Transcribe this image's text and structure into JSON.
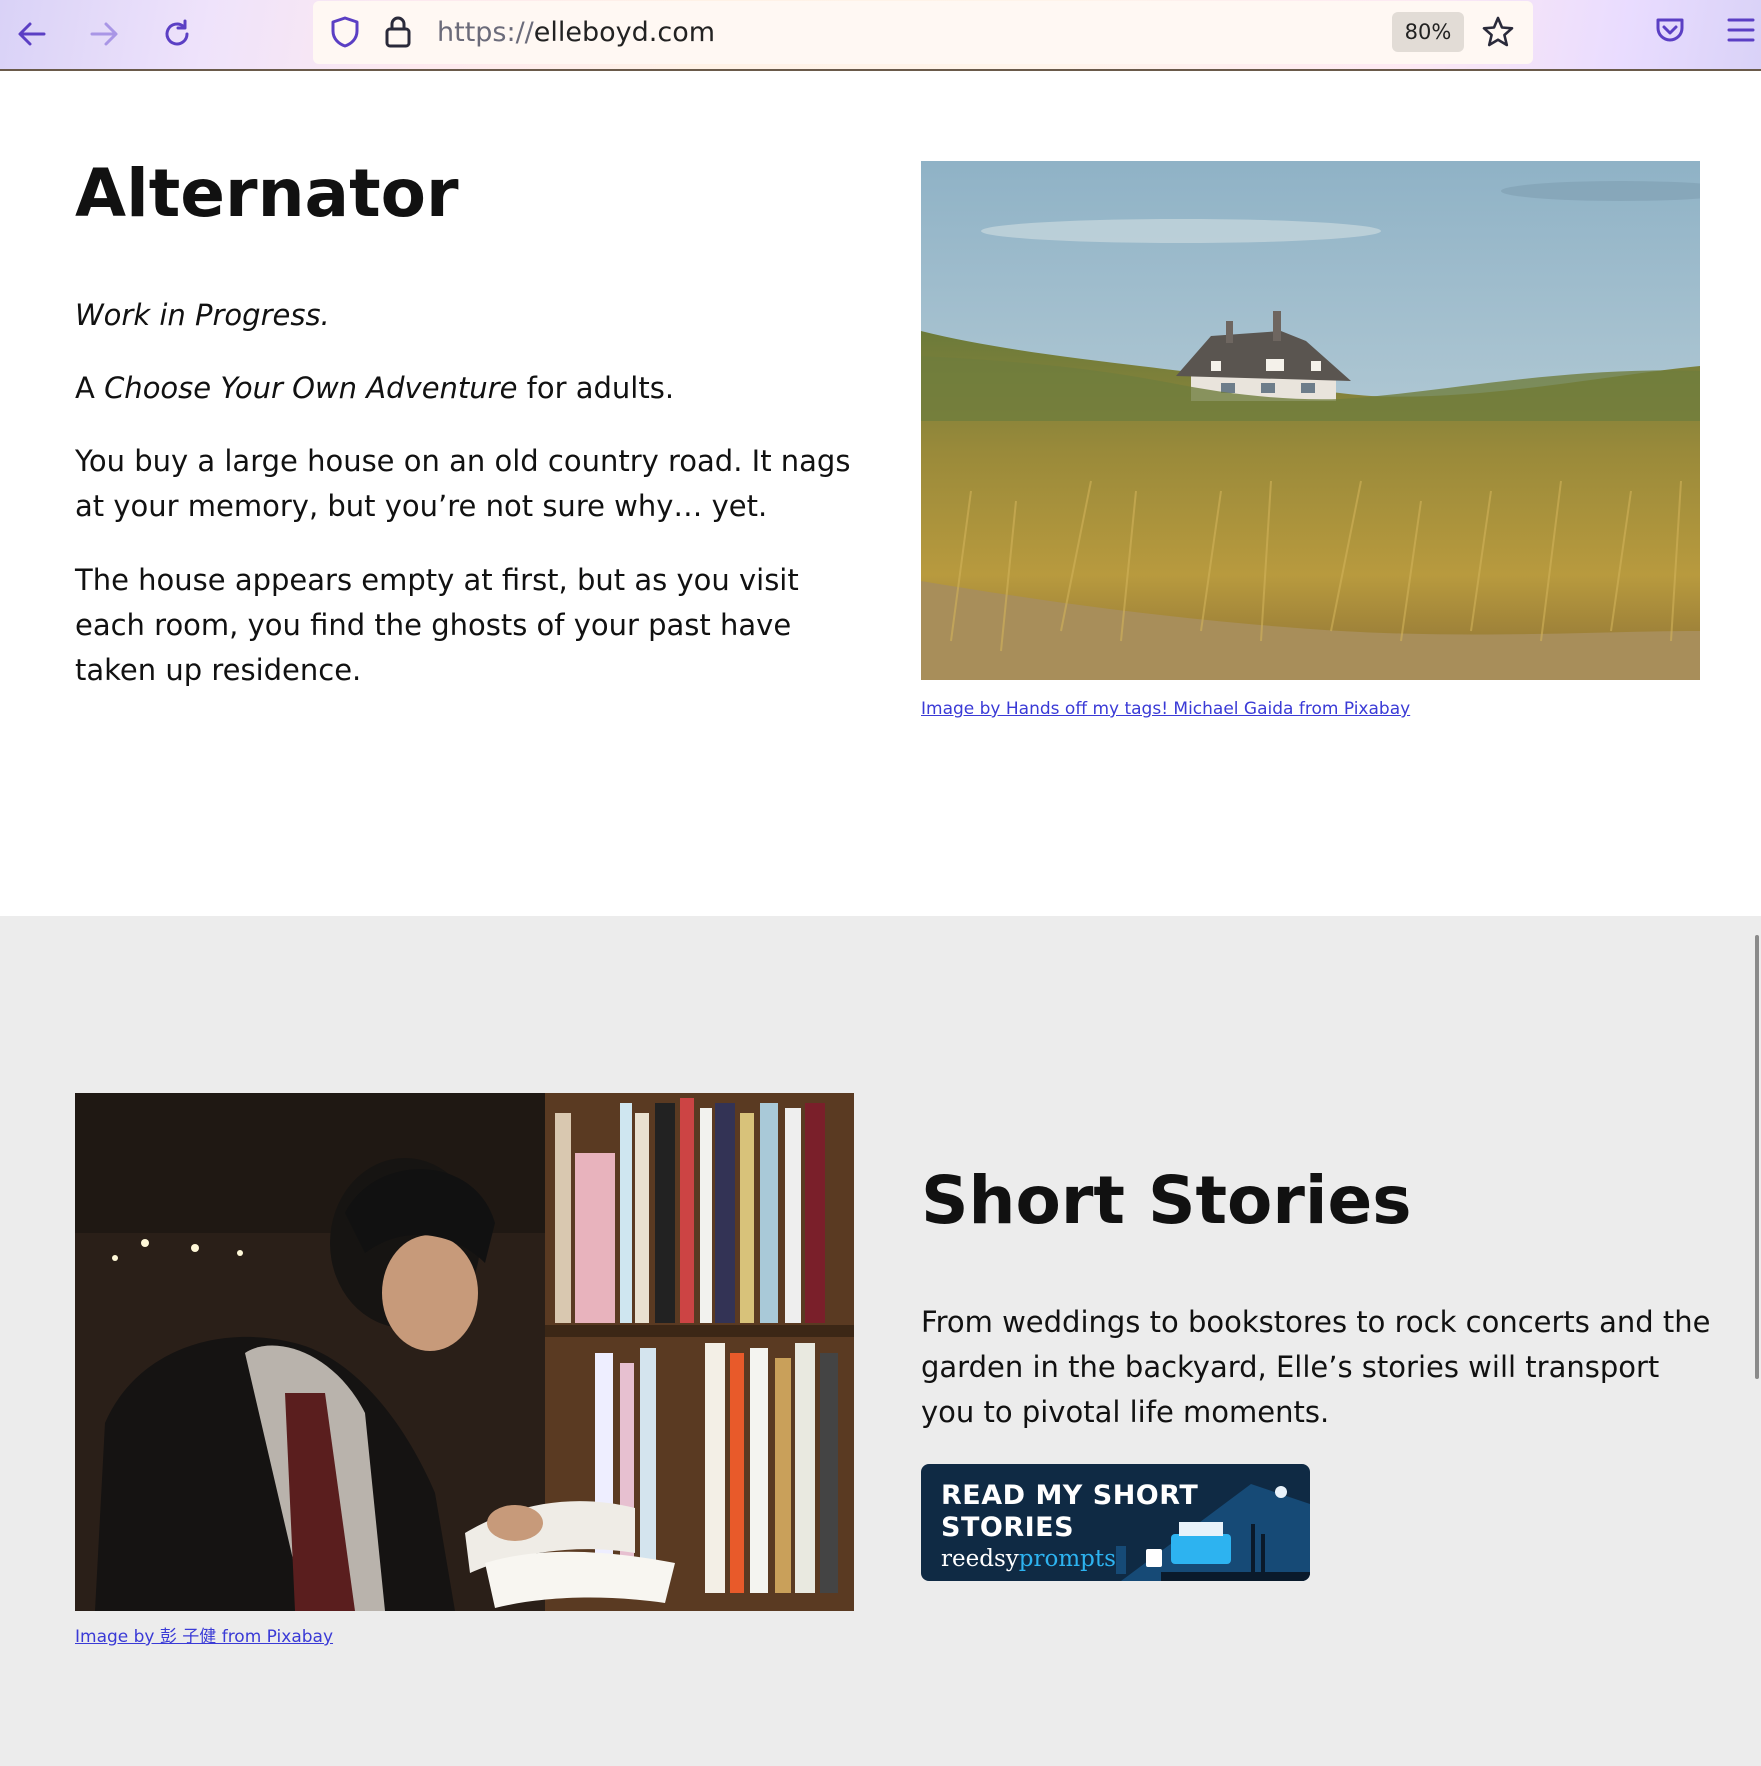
{
  "browser": {
    "url_protocol": "https://",
    "url_host": "elleboyd.com",
    "zoom_label": "80%",
    "icons": [
      "back-arrow-icon",
      "forward-arrow-icon",
      "reload-icon",
      "shield-icon",
      "lock-icon",
      "star-icon",
      "pocket-icon",
      "menu-icon"
    ]
  },
  "alternator": {
    "title": "Alternator",
    "status": "Work in Progress.",
    "tagline_prefix": "A ",
    "tagline_italic": "Choose Your Own Adventure",
    "tagline_suffix": " for adults.",
    "para1": "You buy a large house on an old country road. It nags at your memory, but you’re not sure why… yet.",
    "para2": "The house appears empty at first, but as you visit each room, you find the ghosts of your past have taken up residence.",
    "image_credit": "Image by Hands off my tags! Michael Gaida from Pixabay"
  },
  "short_stories": {
    "title": "Short Stories",
    "description": "From weddings to bookstores to rock concerts and the garden in the backyard, Elle’s stories will transport you to pivotal life moments.",
    "image_credit": "Image by 彭 子健 from Pixabay",
    "banner": {
      "line1": "READ MY SHORT",
      "line2": "STORIES",
      "brand_part1": "reedsy",
      "brand_part2": "prompts"
    }
  },
  "colors": {
    "section2_bg": "#ececec",
    "link": "#3a3ad6",
    "banner_bg": "#0f2a44",
    "banner_accent": "#2db3f0"
  }
}
